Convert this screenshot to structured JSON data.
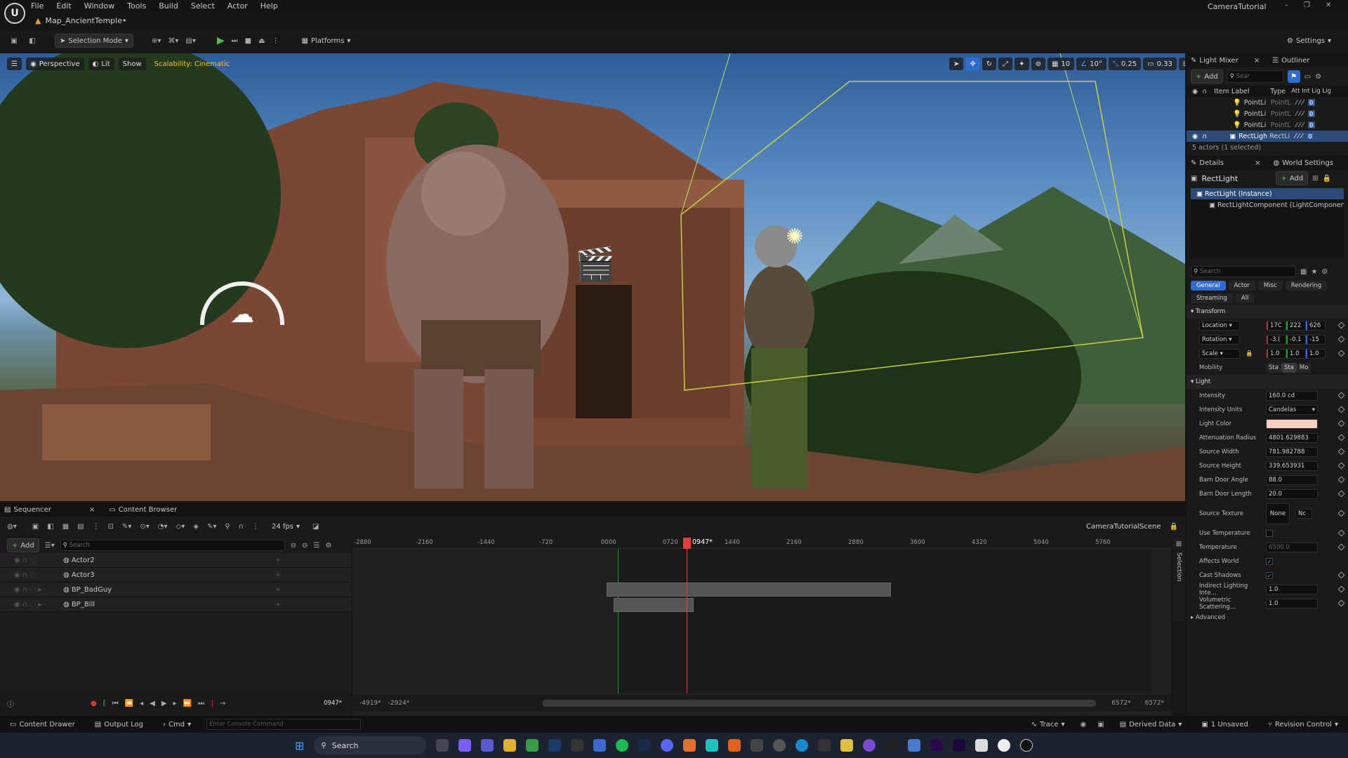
{
  "app": {
    "project_name": "CameraTutorial",
    "map_tab": "Map_AncientTemple•",
    "menu": [
      "File",
      "Edit",
      "Window",
      "Tools",
      "Build",
      "Select",
      "Actor",
      "Help"
    ]
  },
  "toolbar": {
    "selection_mode": "Selection Mode",
    "platforms": "Platforms",
    "settings": "Settings"
  },
  "viewport": {
    "perspective": "Perspective",
    "lit": "Lit",
    "show": "Show",
    "scalability": "Scalability: Cinematic",
    "grid_snap": "10",
    "rotation_snap": "10°",
    "scale_snap": "0.25",
    "camera_speed": "0.33"
  },
  "outliner": {
    "tab_light_mixer": "Light Mixer",
    "tab_outliner": "Outliner",
    "add_label": "Add",
    "search_placeholder": "Sear",
    "col_label": "Item Label",
    "col_type": "Type",
    "col_flags": "Att Int Lig Lig",
    "rows": [
      {
        "label": "PointLi",
        "type": "PointL",
        "selected": false
      },
      {
        "label": "PointLi",
        "type": "PointL",
        "selected": false
      },
      {
        "label": "PointLi",
        "type": "PointL",
        "selected": false
      },
      {
        "label": "RectLigh",
        "type": "RectLi",
        "selected": true
      }
    ],
    "status": "5 actors (1 selected)"
  },
  "details": {
    "tab_details": "Details",
    "tab_world": "World Settings",
    "actor_name": "RectLight",
    "add_label": "Add",
    "instance": "RectLight (Instance)",
    "component": "RectLightComponent (LightComponent(",
    "search_placeholder": "Search",
    "filters": [
      "General",
      "Actor",
      "Misc",
      "Rendering",
      "Streaming",
      "All"
    ],
    "transform_header": "Transform",
    "location_label": "Location",
    "location": [
      "17C",
      "222",
      "626"
    ],
    "rotation_label": "Rotation",
    "rotation": [
      "-3.(",
      "-0.1",
      "-15"
    ],
    "scale_label": "Scale",
    "scale": [
      "1.0",
      "1.0",
      "1.0"
    ],
    "mobility_label": "Mobility",
    "mobility": [
      "Sta",
      "Sta",
      "Mo"
    ],
    "light_header": "Light",
    "intensity_label": "Intensity",
    "intensity": "160.0 cd",
    "intensity_units_label": "Intensity Units",
    "intensity_units": "Candelas",
    "light_color_label": "Light Color",
    "light_color": "#f6cfc2",
    "atten_label": "Attenuation Radius",
    "atten": "4801.629883",
    "src_width_label": "Source Width",
    "src_width": "781.982788",
    "src_height_label": "Source Height",
    "src_height": "339.653931",
    "barn_angle_label": "Barn Door Angle",
    "barn_angle": "88.0",
    "barn_length_label": "Barn Door Length",
    "barn_length": "20.0",
    "source_texture_label": "Source Texture",
    "source_texture": "None",
    "source_texture_sel": "Nc",
    "use_temp_label": "Use Temperature",
    "temperature_label": "Temperature",
    "temperature": "6500.0",
    "affects_world_label": "Affects World",
    "cast_shadows_label": "Cast Shadows",
    "indirect_label": "Indirect Lighting Inte...",
    "indirect": "1.0",
    "volumetric_label": "Volumetric Scattering...",
    "volumetric": "1.0",
    "advanced_label": "Advanced"
  },
  "sequencer": {
    "tab_sequencer": "Sequencer",
    "tab_content": "Content Browser",
    "fps": "24 fps",
    "scene_name": "CameraTutorialScene",
    "add_label": "Add",
    "search_placeholder": "Search",
    "tracks": [
      "Actor2",
      "Actor3",
      "BP_BadGuy",
      "BP_Bill"
    ],
    "playhead": "0947*",
    "current_frame": "0947*",
    "ruler_ticks": [
      "-2880",
      "-2160",
      "-1440",
      "-720",
      "0000",
      "0720",
      "1440",
      "2160",
      "2880",
      "3600",
      "4320",
      "5040",
      "5760"
    ],
    "range_start_1": "-4919*",
    "range_start_2": "-2924*",
    "range_end_1": "6572*",
    "range_end_2": "6572*",
    "selection_label": "Selection"
  },
  "statusbar": {
    "content_drawer": "Content Drawer",
    "output_log": "Output Log",
    "cmd": "Cmd",
    "console_placeholder": "Enter Console Command",
    "trace": "Trace",
    "derived_data": "Derived Data",
    "unsaved": "1 Unsaved",
    "revision": "Revision Control"
  },
  "taskbar": {
    "search_label": "Search"
  }
}
